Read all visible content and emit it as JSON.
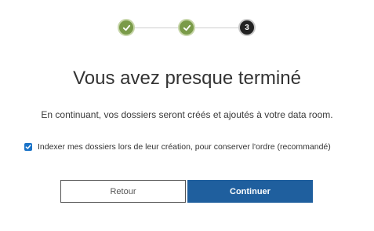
{
  "stepper": {
    "steps": [
      {
        "state": "done",
        "icon": "check-icon"
      },
      {
        "state": "done",
        "icon": "check-icon"
      },
      {
        "state": "current",
        "label": "3"
      }
    ]
  },
  "title": "Vous avez presque terminé",
  "subtitle": "En continuant, vos dossiers seront créés et ajoutés à votre data room.",
  "index_option": {
    "checked": true,
    "label": "Indexer mes dossiers lors de leur création, pour conserver l'ordre (recommandé)"
  },
  "buttons": {
    "back_label": "Retour",
    "continue_label": "Continuer"
  },
  "colors": {
    "step_done": "#7a9b49",
    "step_current": "#222222",
    "primary": "#1f5f9e",
    "checkbox": "#1a73c8"
  }
}
